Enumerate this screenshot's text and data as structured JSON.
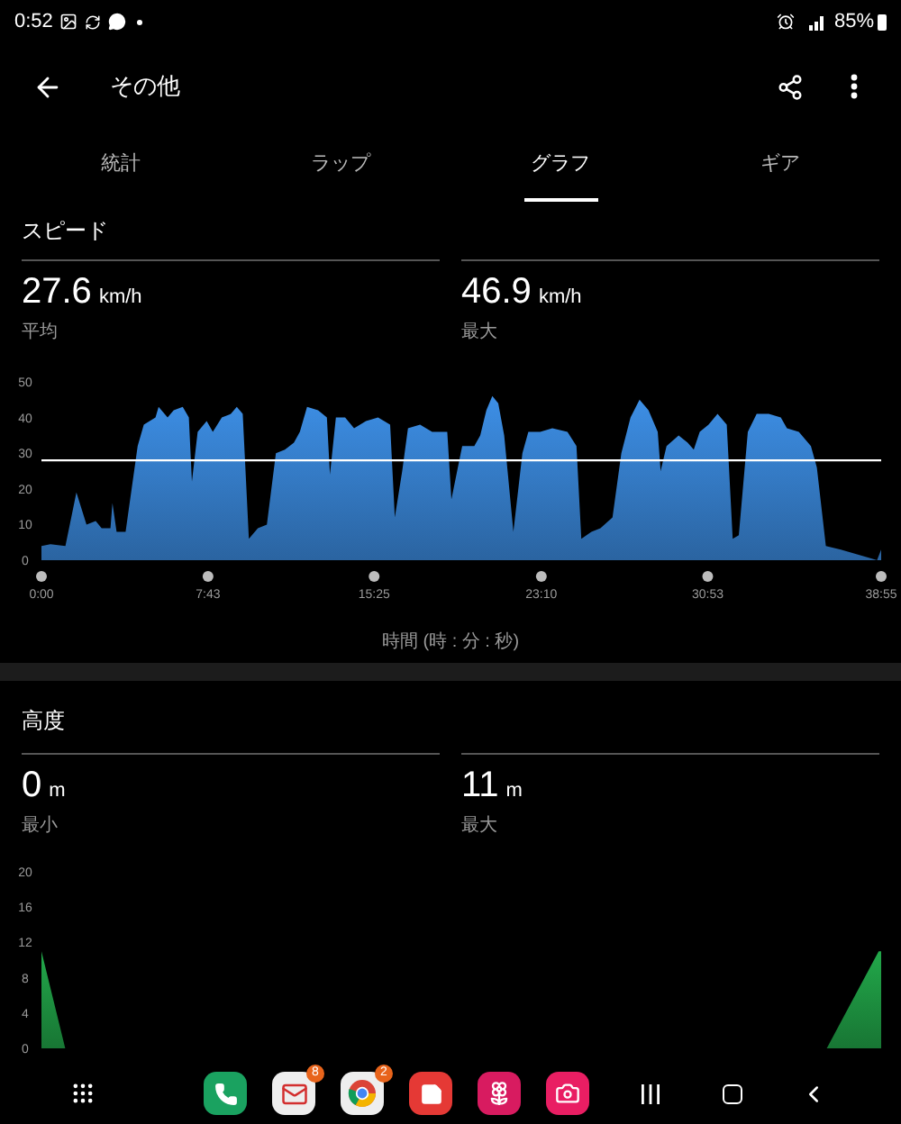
{
  "status_bar": {
    "time": "0:52",
    "battery": "85%"
  },
  "app_bar": {
    "title": "その他"
  },
  "tabs": [
    {
      "label": "統計",
      "selected": false
    },
    {
      "label": "ラップ",
      "selected": false
    },
    {
      "label": "グラフ",
      "selected": true
    },
    {
      "label": "ギア",
      "selected": false
    }
  ],
  "sections": [
    {
      "title": "スピード",
      "stats": [
        {
          "value": "27.6",
          "unit": "km/h",
          "label": "平均"
        },
        {
          "value": "46.9",
          "unit": "km/h",
          "label": "最大"
        }
      ],
      "chart_data": {
        "type": "area",
        "xlim": [
          0,
          38.92
        ],
        "ylim": [
          0,
          50
        ],
        "yticks": [
          0,
          10,
          20,
          30,
          40,
          50
        ],
        "xticks": [
          {
            "value": 0,
            "label": "0:00"
          },
          {
            "value": 7.72,
            "label": "7:43"
          },
          {
            "value": 15.42,
            "label": "15:25"
          },
          {
            "value": 23.17,
            "label": "23:10"
          },
          {
            "value": 30.88,
            "label": "30:53"
          },
          {
            "value": 38.92,
            "label": "38:55"
          }
        ],
        "x": [
          0,
          0.42,
          1.11,
          1.62,
          2.09,
          2.51,
          2.79,
          3.2,
          3.29,
          3.48,
          3.9,
          4.46,
          4.74,
          5.29,
          5.43,
          5.85,
          6.13,
          6.55,
          6.83,
          6.97,
          7.24,
          7.66,
          7.94,
          8.36,
          8.78,
          9.05,
          9.33,
          9.61,
          10.03,
          10.45,
          10.87,
          11.28,
          11.7,
          11.98,
          12.31,
          12.82,
          13.23,
          13.37,
          13.65,
          14.07,
          14.49,
          15.04,
          15.6,
          16.16,
          16.38,
          16.72,
          16.99,
          17.55,
          18.11,
          18.81,
          19,
          19.5,
          20.06,
          20.34,
          20.62,
          20.9,
          21.17,
          21.45,
          21.87,
          22.29,
          22.57,
          23.12,
          23.68,
          24.38,
          24.8,
          25.02,
          25.49,
          25.91,
          26.47,
          26.88,
          27.3,
          27.72,
          28.14,
          28.56,
          28.7,
          28.97,
          29.53,
          29.95,
          30.23,
          30.51,
          30.92,
          31.34,
          31.76,
          32.04,
          32.32,
          32.74,
          33.15,
          33.71,
          34.27,
          34.55,
          35.1,
          35.66,
          35.94,
          36.36,
          37.05,
          38.45,
          38.73,
          38.92
        ],
        "series": [
          {
            "color": "#3d8fe6",
            "values": [
              4,
              4.5,
              4,
              19,
              10,
              11,
              9,
              9,
              16,
              8,
              8,
              32,
              38,
              40,
              43,
              40,
              42,
              43,
              40,
              22,
              36,
              39,
              36,
              40,
              41,
              43,
              41,
              6,
              9,
              10,
              30,
              31,
              33,
              36,
              43,
              42,
              40,
              24,
              40,
              40,
              37,
              39,
              40,
              38,
              12,
              25,
              37,
              38,
              36,
              36,
              17,
              32,
              32,
              35,
              42,
              46,
              44,
              35,
              8,
              30,
              36,
              36,
              37,
              36,
              32,
              6,
              8,
              9,
              12,
              30,
              40,
              45,
              42,
              36,
              25,
              32,
              35,
              33,
              31,
              36,
              38,
              41,
              38,
              6,
              7,
              36,
              41,
              41,
              40,
              37,
              36,
              32,
              26,
              4,
              3,
              0.5,
              0,
              3
            ]
          }
        ],
        "ref_lines": [
          {
            "value": 28,
            "axis": "y"
          }
        ],
        "xlabel": "時間 (時 : 分 : 秒)"
      }
    },
    {
      "title": "高度",
      "stats": [
        {
          "value": "0",
          "unit": "m",
          "label": "最小"
        },
        {
          "value": "11",
          "unit": "m",
          "label": "最大"
        }
      ],
      "chart_data": {
        "type": "area",
        "xlim": [
          0,
          38.92
        ],
        "ylim": [
          0,
          20
        ],
        "yticks": [
          0,
          4,
          8,
          12,
          16,
          20
        ],
        "x": [
          0,
          1.1,
          36.4,
          38.8,
          38.92
        ],
        "series": [
          {
            "color": "#22a84a",
            "values": [
              11,
              0,
              0,
              11,
              11
            ]
          }
        ]
      }
    }
  ],
  "dock": {
    "apps": [
      {
        "kind": "phone"
      },
      {
        "kind": "mail",
        "badge": "8"
      },
      {
        "kind": "browser",
        "badge": "2"
      },
      {
        "kind": "notes"
      },
      {
        "kind": "flower"
      },
      {
        "kind": "camera"
      }
    ]
  }
}
